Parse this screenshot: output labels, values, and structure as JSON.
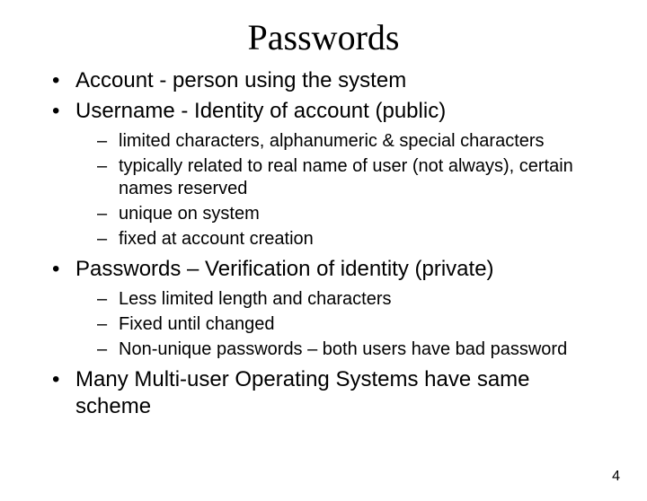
{
  "title": "Passwords",
  "bullets": [
    {
      "text": "Account - person using the system"
    },
    {
      "text": "Username - Identity of account (public)",
      "sub": [
        "limited characters, alphanumeric & special characters",
        "typically related to real name of user (not always), certain names reserved",
        "unique on system",
        "fixed at account creation"
      ]
    },
    {
      "text": "Passwords – Verification of identity (private)",
      "sub": [
        "Less limited length and characters",
        "Fixed until changed",
        "Non-unique passwords – both users have bad password"
      ]
    },
    {
      "text": "Many Multi-user Operating Systems have same scheme"
    }
  ],
  "page_number": "4"
}
